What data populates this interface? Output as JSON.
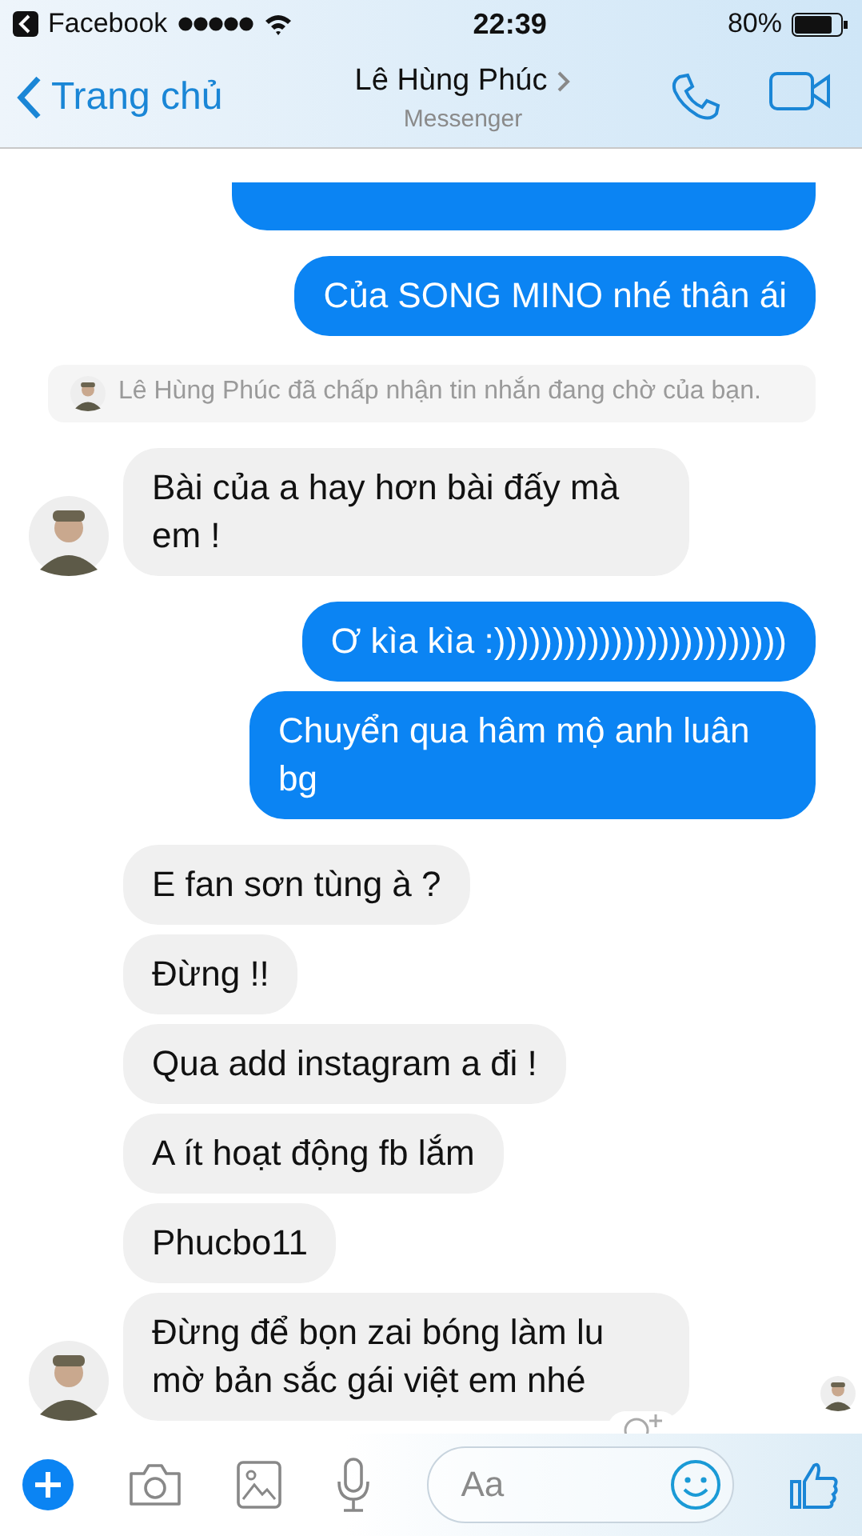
{
  "status_bar": {
    "back_app": "Facebook",
    "time": "22:39",
    "battery": "80%"
  },
  "header": {
    "back": "Trang chủ",
    "title": "Lê Hùng Phúc",
    "subtitle": "Messenger"
  },
  "messages": [
    {
      "kind": "partial"
    },
    {
      "kind": "sent",
      "text": "Của SONG MINO nhé thân ái"
    },
    {
      "kind": "notice",
      "text": "Lê Hùng Phúc đã chấp nhận tin nhắn đang chờ của bạn."
    },
    {
      "kind": "received",
      "text": "Bài của a hay hơn bài đấy mà em !",
      "avatar": true
    },
    {
      "kind": "sent",
      "text": "Ơ kìa kìa :)))))))))))))))))))))))))"
    },
    {
      "kind": "sent",
      "text": "Chuyển qua hâm mộ anh luân bg"
    },
    {
      "kind": "received",
      "text": "E fan sơn tùng à ?",
      "avatar": false
    },
    {
      "kind": "received",
      "text": "Đừng !!",
      "avatar": false
    },
    {
      "kind": "received",
      "text": "Qua add instagram a đi !",
      "avatar": false
    },
    {
      "kind": "received",
      "text": "A ít hoạt động fb lắm",
      "avatar": false
    },
    {
      "kind": "received",
      "text": "Phucbo11",
      "avatar": false
    },
    {
      "kind": "received",
      "text": "Đừng để bọn zai bóng làm lu mờ bản sắc gái việt em nhé",
      "avatar": true
    }
  ],
  "composer": {
    "placeholder": "Aa"
  }
}
